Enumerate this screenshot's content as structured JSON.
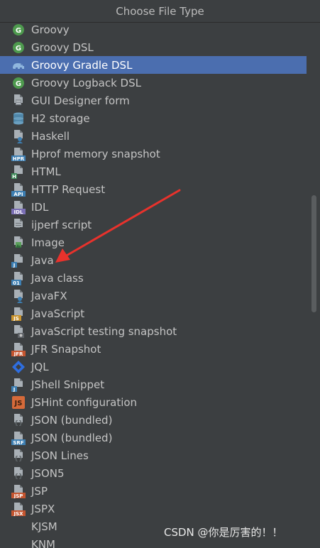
{
  "dialog": {
    "title": "Choose File Type"
  },
  "watermark": "CSDN @你是厉害的！！",
  "selected_index": 2,
  "items": [
    {
      "label": "Groovy",
      "icon": "groovy-icon"
    },
    {
      "label": "Groovy DSL",
      "icon": "groovy-icon"
    },
    {
      "label": "Groovy Gradle DSL",
      "icon": "gradle-elephant-icon"
    },
    {
      "label": "Groovy Logback DSL",
      "icon": "groovy-icon"
    },
    {
      "label": "GUI Designer form",
      "icon": "gui-form-icon"
    },
    {
      "label": "H2 storage",
      "icon": "database-icon"
    },
    {
      "label": "Haskell",
      "icon": "haskell-file-icon"
    },
    {
      "label": "Hprof memory snapshot",
      "icon": "hprof-file-icon",
      "badge": "HPR"
    },
    {
      "label": "HTML",
      "icon": "html-file-icon",
      "badge": "H"
    },
    {
      "label": "HTTP Request",
      "icon": "http-request-file-icon",
      "badge": "API"
    },
    {
      "label": "IDL",
      "icon": "idl-file-icon",
      "badge": "IDL"
    },
    {
      "label": "ijperf script",
      "icon": "text-file-icon"
    },
    {
      "label": "Image",
      "icon": "image-file-icon"
    },
    {
      "label": "Java",
      "icon": "java-file-icon",
      "badge": "J"
    },
    {
      "label": "Java class",
      "icon": "java-class-file-icon",
      "badge": "01"
    },
    {
      "label": "JavaFX",
      "icon": "javafx-file-icon"
    },
    {
      "label": "JavaScript",
      "icon": "javascript-file-icon",
      "badge": "JS"
    },
    {
      "label": "JavaScript testing snapshot",
      "icon": "js-snapshot-file-icon"
    },
    {
      "label": "JFR Snapshot",
      "icon": "jfr-file-icon",
      "badge": "JFR"
    },
    {
      "label": "JQL",
      "icon": "jql-diamond-icon"
    },
    {
      "label": "JShell Snippet",
      "icon": "jshell-file-icon",
      "badge": "J"
    },
    {
      "label": "JSHint configuration",
      "icon": "jshint-icon",
      "badge": "JS"
    },
    {
      "label": "JSON (bundled)",
      "icon": "json-file-icon",
      "badge": "{}"
    },
    {
      "label": "JSON (bundled)",
      "icon": "json-srf-file-icon",
      "badge": "SRF"
    },
    {
      "label": "JSON Lines",
      "icon": "json-lines-file-icon",
      "badge": "{}"
    },
    {
      "label": "JSON5",
      "icon": "json5-file-icon",
      "badge": "{}"
    },
    {
      "label": "JSP",
      "icon": "jsp-file-icon",
      "badge": "JSP"
    },
    {
      "label": "JSPX",
      "icon": "jspx-file-icon",
      "badge": "JSX"
    },
    {
      "label": "KJSM",
      "icon": ""
    },
    {
      "label": "KNM",
      "icon": ""
    }
  ],
  "colors": {
    "background": "#3c3f41",
    "selection": "#4b6eaf",
    "groovy": "#4e9a4e",
    "arrow": "#e8322c"
  }
}
